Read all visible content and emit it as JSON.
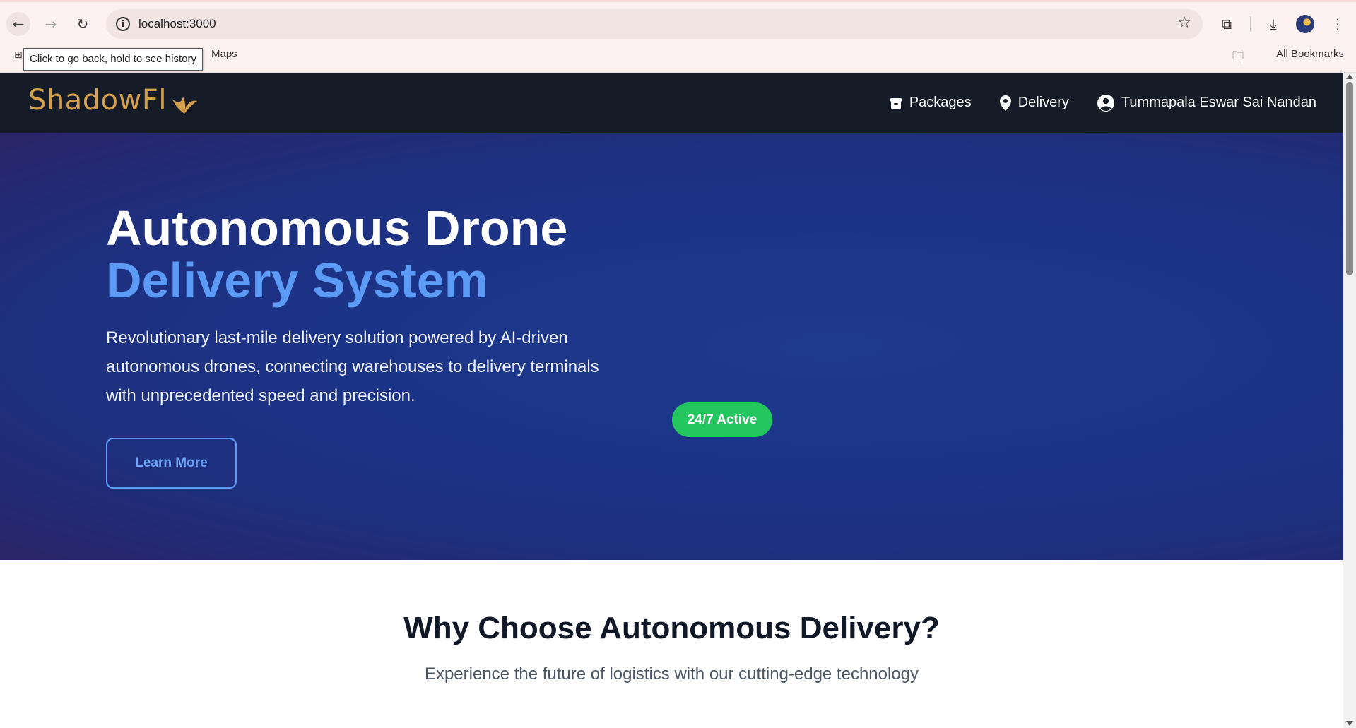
{
  "browser": {
    "url": "localhost:3000",
    "tooltip": "Click to go back, hold to see history",
    "bookmarks": {
      "maps_label": "Maps",
      "all_label": "All Bookmarks"
    }
  },
  "site": {
    "logo_text": "ShadowFl",
    "nav": {
      "packages_label": "Packages",
      "delivery_label": "Delivery",
      "user_label": "Tummapala Eswar Sai Nandan"
    }
  },
  "hero": {
    "title_line1": "Autonomous Drone",
    "title_line2": "Delivery System",
    "description": "Revolutionary last-mile delivery solution powered by AI-driven autonomous drones, connecting warehouses to delivery terminals with unprecedented speed and precision.",
    "learn_more_label": "Learn More",
    "status_badge": "24/7 Active"
  },
  "why": {
    "title": "Why Choose Autonomous Delivery?",
    "subtitle": "Experience the future of logistics with our cutting-edge technology"
  },
  "colors": {
    "nav_bg": "#151c28",
    "logo": "#d4a04c",
    "hero_bg": "#1e3a8a",
    "accent_blue": "#5b9af5",
    "badge_green": "#22c55e"
  }
}
